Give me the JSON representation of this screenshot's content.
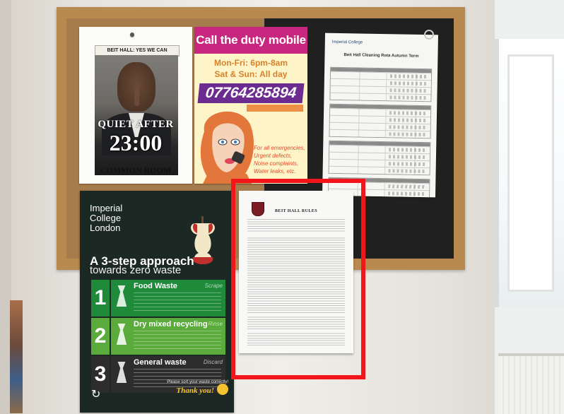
{
  "posters": {
    "quiet": {
      "banner": "BEIT HALL: YES WE CAN",
      "line1": "QUIET AFTER",
      "time": "23:00",
      "small": "",
      "line2": "COMMON ROOM"
    },
    "duty": {
      "heading": "Call the duty mobile",
      "hours_weekday": "Mon-Fri: 6pm-8am",
      "hours_weekend": "Sat & Sun: All day",
      "phone": "07764285894",
      "phone_sub": "",
      "note": "For all emergencies, Urgent defects, Noise complaints, Water leaks, etc."
    },
    "schedule": {
      "org": "Imperial College",
      "title": "Beit Hall Cleaning Rota Autumn Term"
    },
    "waste": {
      "logo": "Imperial College London",
      "kicker": "",
      "title": "A 3-step approach",
      "subtitle": "towards zero waste",
      "steps": [
        {
          "num": "1",
          "title": "Food Waste",
          "tag": "Scrape",
          "color": "#1f8a3a"
        },
        {
          "num": "2",
          "title": "Dry mixed recycling",
          "tag": "Rinse",
          "color": "#5aaa3c"
        },
        {
          "num": "3",
          "title": "General waste",
          "tag": "Discard",
          "color": "#2d2d2d"
        }
      ],
      "footer": "Please sort your waste correctly!",
      "thanks": "Thank you!"
    },
    "rules": {
      "title": "BEIT HALL RULES"
    }
  },
  "highlight_color": "#f2151a"
}
